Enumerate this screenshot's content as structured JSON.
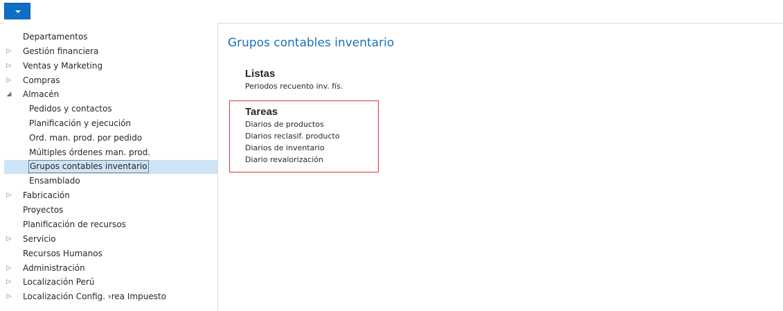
{
  "topbar": {
    "menu_icon": "caret-down-icon",
    "accent_color": "#0f6fc6"
  },
  "sidebar": {
    "items": [
      {
        "label": "Departamentos",
        "level": 0,
        "arrow": ""
      },
      {
        "label": "Gestión financiera",
        "level": 0,
        "arrow": "▷"
      },
      {
        "label": "Ventas y Marketing",
        "level": 0,
        "arrow": "▷"
      },
      {
        "label": "Compras",
        "level": 0,
        "arrow": "▷"
      },
      {
        "label": "Almacén",
        "level": 0,
        "arrow": "◢"
      },
      {
        "label": "Pedidos y contactos",
        "level": 1,
        "arrow": ""
      },
      {
        "label": "Planificación y ejecución",
        "level": 1,
        "arrow": ""
      },
      {
        "label": "Ord. man. prod. por pedido",
        "level": 1,
        "arrow": ""
      },
      {
        "label": "Múltiples órdenes man. prod.",
        "level": 1,
        "arrow": ""
      },
      {
        "label": "Grupos contables inventario",
        "level": 1,
        "arrow": "",
        "selected": true
      },
      {
        "label": "Ensamblado",
        "level": 1,
        "arrow": ""
      },
      {
        "label": "Fabricación",
        "level": 0,
        "arrow": "▷"
      },
      {
        "label": "Proyectos",
        "level": 0,
        "arrow": ""
      },
      {
        "label": "Planificación de recursos",
        "level": 0,
        "arrow": ""
      },
      {
        "label": "Servicio",
        "level": 0,
        "arrow": "▷"
      },
      {
        "label": "Recursos Humanos",
        "level": 0,
        "arrow": ""
      },
      {
        "label": "Administración",
        "level": 0,
        "arrow": "▷"
      },
      {
        "label": "Localización Perú",
        "level": 0,
        "arrow": "▷"
      },
      {
        "label": "Localización Config. ›rea Impuesto",
        "level": 0,
        "arrow": "▷"
      }
    ]
  },
  "main": {
    "title": "Grupos contables inventario",
    "listas": {
      "heading": "Listas",
      "links": [
        "Periodos recuento inv. fís."
      ]
    },
    "tareas": {
      "heading": "Tareas",
      "links": [
        "Diarios de productos",
        "Diarios reclasif. producto",
        "Diarios de inventario",
        "Diario revalorización"
      ],
      "highlight_color": "#d9363e"
    }
  }
}
